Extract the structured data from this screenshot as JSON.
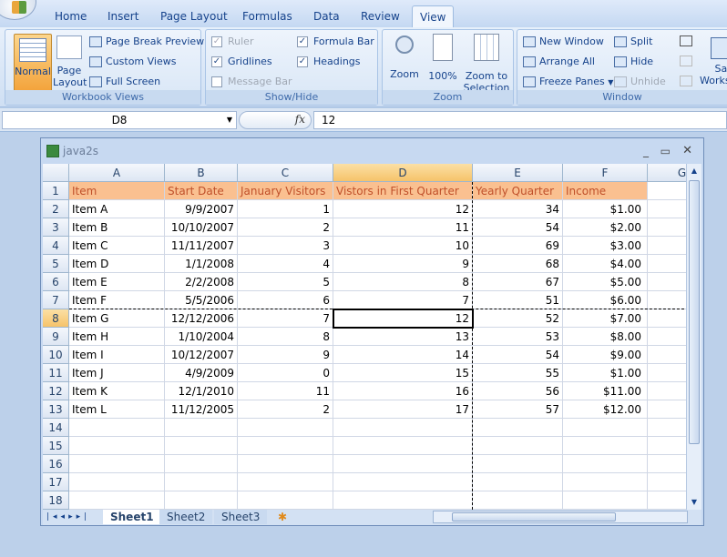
{
  "ribbon": {
    "tabs": [
      "Home",
      "Insert",
      "Page Layout",
      "Formulas",
      "Data",
      "Review",
      "View"
    ],
    "active_tab": "View",
    "workbook_views": {
      "label": "Workbook Views",
      "normal": "Normal",
      "page_layout": "Page Layout",
      "page_break_preview": "Page Break Preview",
      "custom_views": "Custom Views",
      "full_screen": "Full Screen"
    },
    "show_hide": {
      "label": "Show/Hide",
      "ruler": "Ruler",
      "gridlines": "Gridlines",
      "message_bar": "Message Bar",
      "formula_bar": "Formula Bar",
      "headings": "Headings"
    },
    "zoom": {
      "label": "Zoom",
      "zoom": "Zoom",
      "hundred": "100%",
      "zoom_to_selection": "Zoom to Selection"
    },
    "window": {
      "label": "Window",
      "new_window": "New Window",
      "arrange_all": "Arrange All",
      "freeze_panes": "Freeze Panes",
      "split": "Split",
      "hide": "Hide",
      "unhide": "Unhide",
      "save_workspace": "Save Workspace"
    }
  },
  "formula_bar": {
    "name_box": "D8",
    "fx": "fx",
    "value": "12"
  },
  "workbook": {
    "title": "java2s",
    "columns": [
      "A",
      "B",
      "C",
      "D",
      "E",
      "F",
      "G"
    ],
    "selected_cell": "D8",
    "header_row": [
      "Item",
      "Start Date",
      "January Visitors",
      "Vistors in First Quarter",
      "Yearly Quarter",
      "Income"
    ],
    "rows": [
      [
        "Item A",
        "9/9/2007",
        "1",
        "12",
        "34",
        "1.00"
      ],
      [
        "Item B",
        "10/10/2007",
        "2",
        "11",
        "54",
        "2.00"
      ],
      [
        "Item C",
        "11/11/2007",
        "3",
        "10",
        "69",
        "3.00"
      ],
      [
        "Item D",
        "1/1/2008",
        "4",
        "9",
        "68",
        "4.00"
      ],
      [
        "Item E",
        "2/2/2008",
        "5",
        "8",
        "67",
        "5.00"
      ],
      [
        "Item F",
        "5/5/2006",
        "6",
        "7",
        "51",
        "6.00"
      ],
      [
        "Item G",
        "12/12/2006",
        "7",
        "12",
        "52",
        "7.00"
      ],
      [
        "Item H",
        "1/10/2004",
        "8",
        "13",
        "53",
        "8.00"
      ],
      [
        "Item I",
        "10/12/2007",
        "9",
        "14",
        "54",
        "9.00"
      ],
      [
        "Item J",
        "4/9/2009",
        "0",
        "15",
        "55",
        "1.00"
      ],
      [
        "Item K",
        "12/1/2010",
        "11",
        "16",
        "56",
        "11.00"
      ],
      [
        "Item L",
        "11/12/2005",
        "2",
        "17",
        "57",
        "12.00"
      ]
    ],
    "currency_symbol": "$",
    "row_numbers": [
      "1",
      "2",
      "3",
      "4",
      "5",
      "6",
      "7",
      "8",
      "9",
      "10",
      "11",
      "12",
      "13",
      "14",
      "15",
      "16",
      "17",
      "18"
    ],
    "sheets": [
      "Sheet1",
      "Sheet2",
      "Sheet3"
    ],
    "active_sheet": "Sheet1"
  }
}
